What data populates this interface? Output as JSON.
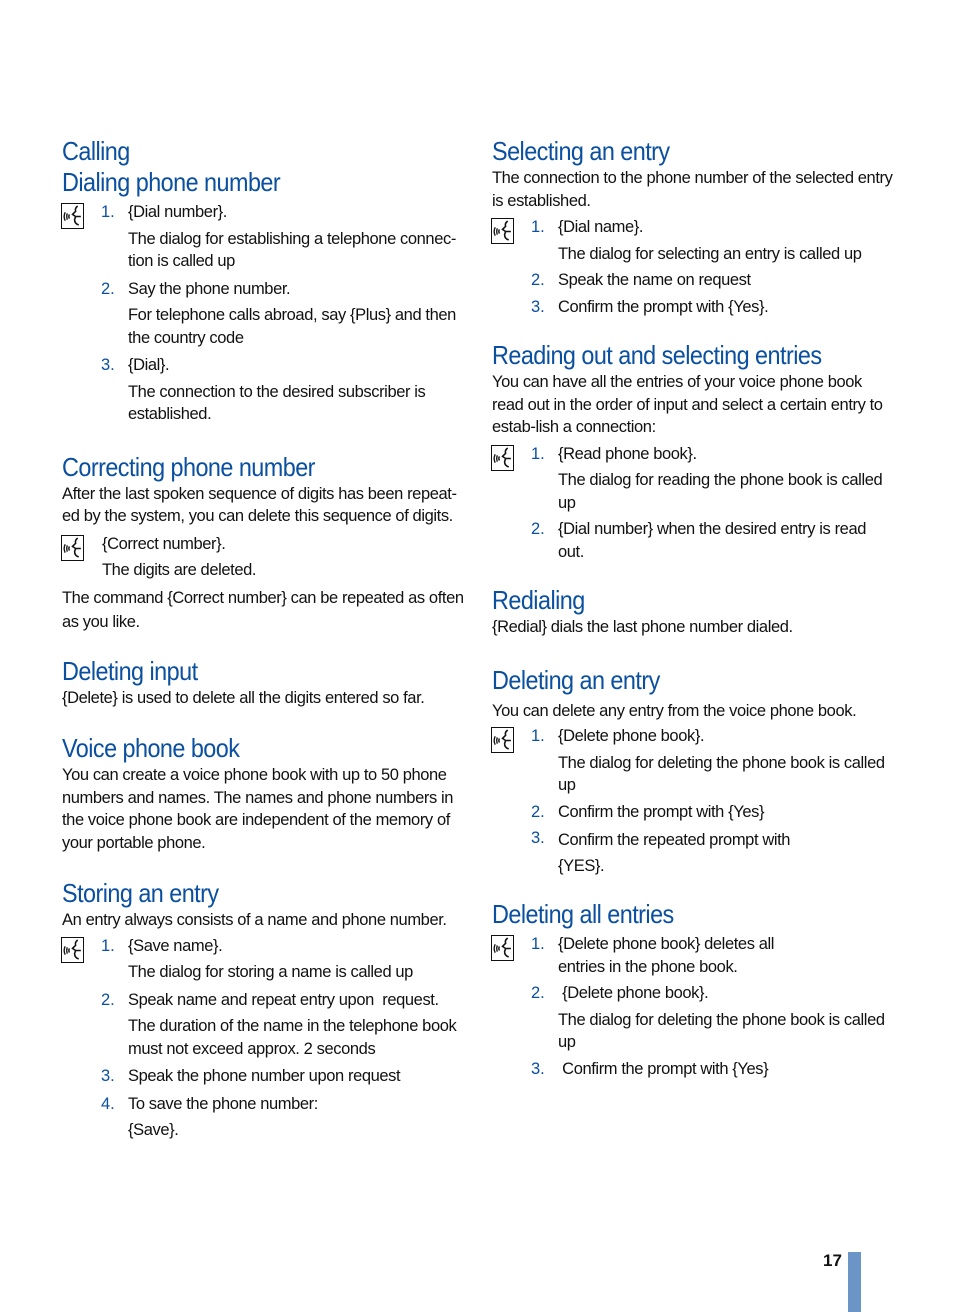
{
  "page_number": "17",
  "colors": {
    "heading": "#0a4fa0",
    "accent_bar": "#6a95c6",
    "text": "#111111"
  },
  "icon": "voice-command-icon",
  "left": {
    "calling": {
      "title": "Calling"
    },
    "dialing": {
      "title": "Dialing phone number",
      "steps": [
        {
          "num": "1.",
          "text": "{Dial number}.",
          "sub": "The dialog for establishing a telephone connec-tion is called up"
        },
        {
          "num": "2.",
          "text": " Say the phone number.",
          "sub": "For telephone calls abroad, say {Plus} and then the country code"
        },
        {
          "num": "3.",
          "text": "{Dial}.",
          "sub": "The connection to the desired subscriber is established."
        }
      ]
    },
    "correcting": {
      "title": "Correcting phone number",
      "intro": "After the last spoken sequence of digits has been repeat-ed by the system, you can delete this sequence of digits.",
      "command": "{Correct number}.",
      "result": "The digits are deleted.",
      "note": "The command {Correct number} can be repeated as often as you like."
    },
    "deleting_input": {
      "title": "Deleting input",
      "text": "{Delete} is used to delete all the digits entered so far."
    },
    "voice_book": {
      "title": "Voice phone book",
      "text": "You can create a voice phone book with up to 50 phone numbers and names. The names and phone numbers in the voice phone book are independent of the memory of your portable phone."
    },
    "storing": {
      "title": "Storing an entry",
      "intro": "An entry always consists of a name and phone number.",
      "steps": [
        {
          "num": "1.",
          "text": "{Save name}.",
          "sub": "The dialog for storing a name is called up"
        },
        {
          "num": "2.",
          "text": "Speak name and repeat entry upon  request.",
          "sub": "The duration of the name in the telephone book must not exceed approx. 2 seconds"
        },
        {
          "num": "3.",
          "text": "Speak the phone number upon request",
          "sub": ""
        },
        {
          "num": "4.",
          "text": "To save the phone number:",
          "sub": "{Save}."
        }
      ]
    }
  },
  "right": {
    "selecting": {
      "title": "Selecting an entry",
      "intro": "The connection to the phone number of the selected entry is established.",
      "steps": [
        {
          "num": "1.",
          "text": "{Dial name}.",
          "sub": "The dialog for selecting an entry is called up"
        },
        {
          "num": "2.",
          "text": "Speak the name on request",
          "sub": ""
        },
        {
          "num": "3.",
          "text": "Confirm the prompt with {Yes}.",
          "sub": ""
        }
      ]
    },
    "reading": {
      "title": "Reading out and selecting entries",
      "intro": "You can have all the entries of your voice phone book read out in the order of input and select a certain entry to estab-lish a connection:",
      "steps": [
        {
          "num": "1.",
          "text": "{Read phone book}.",
          "sub": "The dialog for reading the phone book is called up"
        },
        {
          "num": "2.",
          "text": "{Dial number} when the desired entry is read out.",
          "sub": ""
        }
      ]
    },
    "redialing": {
      "title": "Redialing",
      "text": "{Redial} dials the last phone number dialed."
    },
    "deleting_entry": {
      "title": "Deleting an entry",
      "intro": "You can delete any entry from the voice phone book.",
      "steps": [
        {
          "num": "1.",
          "text": "{Delete phone book}.",
          "sub": "The dialog for deleting the phone book is called up"
        },
        {
          "num": "2.",
          "text": "Confirm the prompt with {Yes}",
          "sub": ""
        },
        {
          "num": "3.",
          "text": "Confirm the repeated prompt with {YES}.",
          "sub": ""
        }
      ]
    },
    "deleting_all": {
      "title": "Deleting all entries",
      "steps": [
        {
          "num": "1.",
          "text": "{Delete phone book} deletes all  entries in the phone book.",
          "sub": ""
        },
        {
          "num": "2.",
          "text": " {Delete phone book}.",
          "sub": "The dialog for deleting the phone book is called up"
        },
        {
          "num": "3.",
          "text": " Confirm the prompt with {Yes}",
          "sub": ""
        }
      ]
    }
  }
}
